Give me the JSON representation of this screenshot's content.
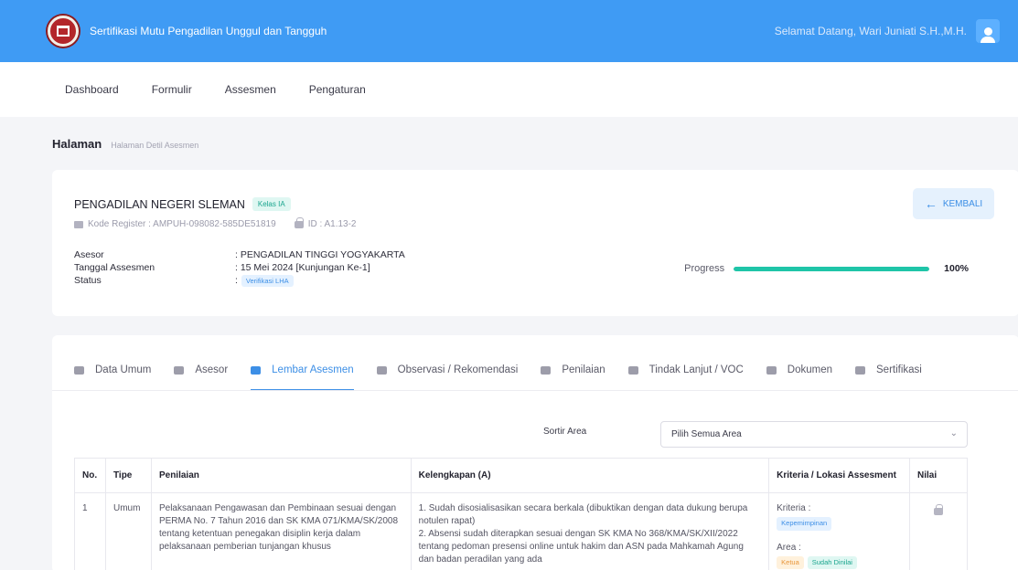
{
  "header": {
    "app_title": "Sertifikasi Mutu Pengadilan Unggul dan Tangguh",
    "welcome": "Selamat Datang, Wari Juniati S.H.,M.H.",
    "accent_color": "#3f9bf4"
  },
  "nav": {
    "items": [
      {
        "label": "Dashboard"
      },
      {
        "label": "Formulir"
      },
      {
        "label": "Assesmen"
      },
      {
        "label": "Pengaturan"
      }
    ]
  },
  "breadcrumb": {
    "title": "Halaman",
    "sub": "Halaman Detil Asesmen"
  },
  "detail": {
    "court_name": "PENGADILAN NEGERI SLEMAN",
    "kelas": "Kelas IA",
    "kode_register": "Kode Register : AMPUH-098082-585DE51819",
    "id": "ID : A1.13-2",
    "asesor_label": "Asesor",
    "asesor_value": ": PENGADILAN TINGGI YOGYAKARTA",
    "tanggal_label": "Tanggal Assesmen",
    "tanggal_value": ": 15 Mei 2024 [Kunjungan Ke-1]",
    "status_label": "Status",
    "status_colon": ":",
    "status_value": "Verifikasi LHA",
    "back_label": "KEMBALI",
    "progress_label": "Progress",
    "progress_value": "100%",
    "progress_fraction": 1.0
  },
  "tabs": [
    {
      "label": "Data Umum",
      "icon": "info-icon",
      "active": false
    },
    {
      "label": "Asesor",
      "icon": "card-icon",
      "active": false
    },
    {
      "label": "Lembar Asesmen",
      "icon": "flag-icon",
      "active": true
    },
    {
      "label": "Observasi / Rekomendasi",
      "icon": "document-icon",
      "active": false
    },
    {
      "label": "Penilaian",
      "icon": "check-circle-icon",
      "active": false
    },
    {
      "label": "Tindak Lanjut / VOC",
      "icon": "document-icon",
      "active": false
    },
    {
      "label": "Dokumen",
      "icon": "document-icon",
      "active": false
    },
    {
      "label": "Sertifikasi",
      "icon": "document-icon",
      "active": false
    }
  ],
  "sort": {
    "label": "Sortir Area",
    "selected": "Pilih Semua Area"
  },
  "table": {
    "headers": [
      "No.",
      "Tipe",
      "Penilaian",
      "Kelengkapan (A)",
      "Kriteria / Lokasi Assesment",
      "Nilai"
    ],
    "rows": [
      {
        "no": "1",
        "tipe": "Umum",
        "penilaian": "Pelaksanaan Pengawasan dan Pembinaan sesuai dengan PERMA No. 7 Tahun 2016 dan SK KMA 071/KMA/SK/2008 tentang ketentuan penegakan disiplin kerja dalam pelaksanaan pemberian tunjangan khusus",
        "kelengkapan_1": "1. Sudah disosialisasikan secara berkala (dibuktikan dengan data dukung berupa notulen rapat)",
        "kelengkapan_2": "2. Absensi sudah diterapkan sesuai dengan SK KMA No 368/KMA/SK/XII/2022 tentang pedoman presensi online untuk hakim dan ASN pada Mahkamah Agung dan badan peradilan yang ada",
        "kriteria_label": "Kriteria :",
        "kriteria_badge": "Kepemimpinan",
        "area_label": "Area :",
        "area_badge_1": "Ketua",
        "area_badge_2": "Sudah Dinilai",
        "nilai_icon": "lock-icon"
      }
    ]
  }
}
